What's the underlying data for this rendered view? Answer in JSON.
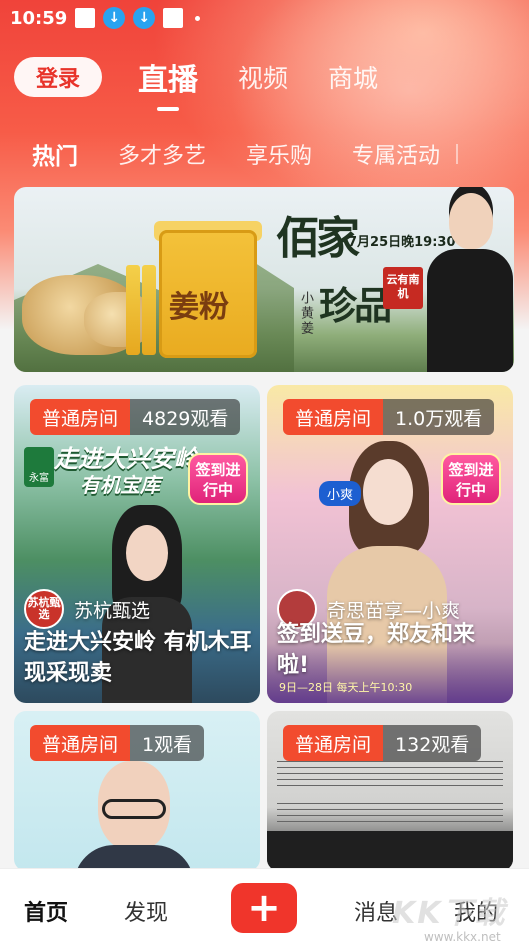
{
  "status_bar": {
    "time": "10:59"
  },
  "top_nav": {
    "login": "登录",
    "tabs": [
      "直播",
      "视频",
      "商城"
    ]
  },
  "sub_nav": [
    "热门",
    "多才多艺",
    "享乐购",
    "专属活动"
  ],
  "banner": {
    "title_line1": "佰家",
    "title_line2": "珍品",
    "date": "7月25日晚19:30",
    "subtitle": "小黄姜",
    "seal": "云有南机",
    "jar_text": "姜粉"
  },
  "cards": [
    {
      "room_type": "普通房间",
      "views": "4829观看",
      "headline": "走进大兴安岭",
      "subheadline": "有机宝库",
      "brand": "永富",
      "sign_tag": "签到进行中",
      "host_avatar_text": "苏杭甄选",
      "host": "苏杭甄选",
      "title": "走进大兴安岭 有机木耳现采现卖"
    },
    {
      "room_type": "普通房间",
      "views": "1.0万观看",
      "sign_tag": "签到进行中",
      "tag": "小爽",
      "host": "奇思苗享—小爽",
      "title": "签到送豆，郑友和来啦!",
      "strip_text": "9日—28日  每天上午10:30"
    },
    {
      "room_type": "普通房间",
      "views": "1观看"
    },
    {
      "room_type": "普通房间",
      "views": "132观看"
    }
  ],
  "bottom_nav": {
    "home": "首页",
    "discover": "发现",
    "plus": "+",
    "messages": "消息",
    "me": "我的"
  },
  "watermark": {
    "text": "KK下载",
    "url": "www.kkx.net"
  },
  "colors": {
    "accent": "#f0352b",
    "badge": "#f24b2e"
  }
}
